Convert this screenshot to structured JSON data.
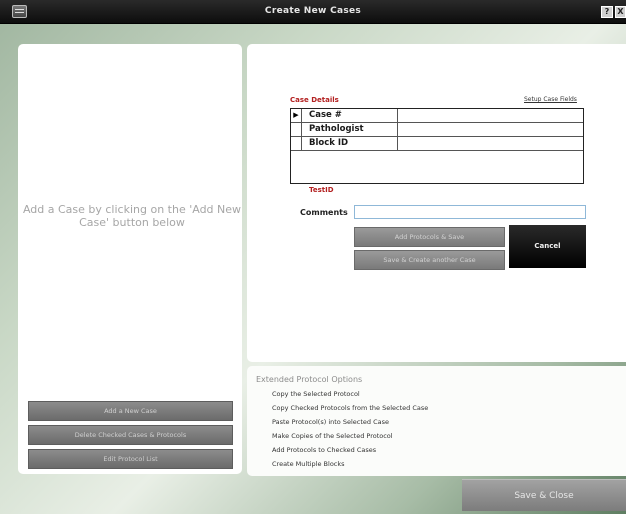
{
  "window": {
    "title": "Create New Cases",
    "help_glyph": "?",
    "close_glyph": "X"
  },
  "left_panel": {
    "hint": "Add a Case by clicking on the 'Add New Case' button below",
    "buttons": {
      "add_new_case": "Add a New Case",
      "delete_checked": "Delete Checked Cases & Protocols",
      "edit_protocol_list": "Edit Protocol List"
    }
  },
  "case_details": {
    "label": "Case Details",
    "setup_link": "Setup Case Fields",
    "row_indicator": "▶",
    "fields": [
      {
        "label": "Case #",
        "value": ""
      },
      {
        "label": "Pathologist",
        "value": ""
      },
      {
        "label": "Block ID",
        "value": ""
      }
    ],
    "test_id_label": "TestID",
    "comments_label": "Comments",
    "comments_value": ""
  },
  "actions": {
    "add_protocols_save": "Add Protocols & Save",
    "save_create_another": "Save & Create another Case",
    "cancel": "Cancel"
  },
  "extended_options": {
    "title": "Extended Protocol Options",
    "items": [
      "Copy the Selected Protocol",
      "Copy Checked  Protocols from the Selected Case",
      "Paste Protocol(s) into Selected Case",
      "Make Copies of the Selected Protocol",
      "Add Protocols to Checked Cases",
      "Create Multiple Blocks"
    ]
  },
  "footer": {
    "save_close": "Save & Close"
  }
}
